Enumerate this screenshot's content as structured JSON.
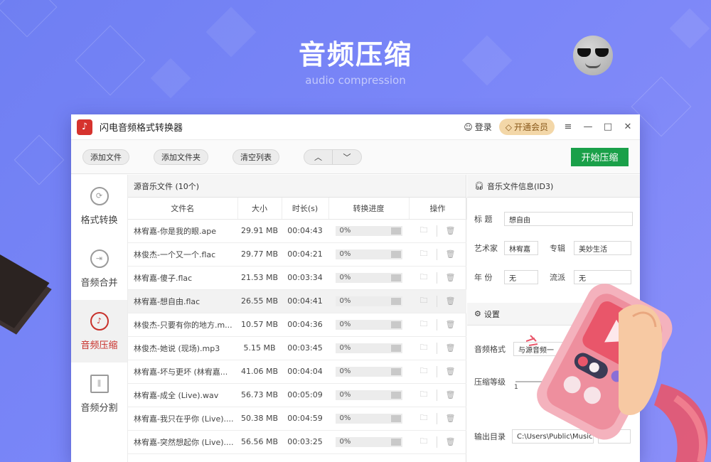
{
  "hero": {
    "title": "音频压缩",
    "subtitle": "audio compression"
  },
  "app": {
    "title": "闪电音频格式转换器",
    "login_label": "登录",
    "vip_label": "开通会员",
    "window_controls": [
      "≡",
      "—",
      "□",
      "✕"
    ]
  },
  "toolbar": {
    "add_file": "添加文件",
    "add_folder": "添加文件夹",
    "clear_list": "清空列表",
    "move_up": "︿",
    "move_down": "﹀",
    "start": "开始压缩"
  },
  "sidebar": {
    "items": [
      {
        "label": "格式转换",
        "icon": "refresh-icon"
      },
      {
        "label": "音频合并",
        "icon": "merge-icon"
      },
      {
        "label": "音频压缩",
        "icon": "music-note-icon",
        "active": true
      },
      {
        "label": "音频分割",
        "icon": "split-icon"
      }
    ]
  },
  "file_list": {
    "header": "源音乐文件 (10个)",
    "columns": [
      "文件名",
      "大小",
      "时长(s)",
      "转换进度",
      "操作"
    ],
    "rows": [
      {
        "name": "林宥嘉-你是我的眼.ape",
        "size": "29.91 MB",
        "duration": "00:04:43",
        "progress": "0%"
      },
      {
        "name": "林俊杰-一个又一个.flac",
        "size": "29.77 MB",
        "duration": "00:04:21",
        "progress": "0%"
      },
      {
        "name": "林宥嘉-傻子.flac",
        "size": "21.53 MB",
        "duration": "00:03:34",
        "progress": "0%"
      },
      {
        "name": "林宥嘉-想自由.flac",
        "size": "26.55 MB",
        "duration": "00:04:41",
        "progress": "0%",
        "selected": true
      },
      {
        "name": "林俊杰-只要有你的地方.m...",
        "size": "10.57 MB",
        "duration": "00:04:36",
        "progress": "0%"
      },
      {
        "name": "林俊杰-她说 (现场).mp3",
        "size": "5.15 MB",
        "duration": "00:03:45",
        "progress": "0%"
      },
      {
        "name": "林宥嘉-坏与更坏 (林宥嘉...",
        "size": "41.06 MB",
        "duration": "00:04:04",
        "progress": "0%"
      },
      {
        "name": "林宥嘉-成全 (Live).wav",
        "size": "56.73 MB",
        "duration": "00:05:09",
        "progress": "0%"
      },
      {
        "name": "林宥嘉-我只在乎你 (Live)....",
        "size": "50.38 MB",
        "duration": "00:04:59",
        "progress": "0%"
      },
      {
        "name": "林宥嘉-突然想起你 (Live)....",
        "size": "56.56 MB",
        "duration": "00:03:25",
        "progress": "0%"
      }
    ]
  },
  "id3": {
    "header": "音乐文件信息(ID3)",
    "title_label": "标    题",
    "title_value": "想自由",
    "artist_label": "艺术家",
    "artist_value": "林宥嘉",
    "album_label": "专辑",
    "album_value": "美妙生活",
    "year_label": "年    份",
    "year_value": "无",
    "genre_label": "流派",
    "genre_value": "无"
  },
  "settings": {
    "header": "设置",
    "format_label": "音频格式",
    "format_value": "与源音频一",
    "level_label": "压缩等级",
    "level_min": "1",
    "output_label": "输出目录",
    "output_value": "C:\\Users\\Public\\Music\\"
  },
  "colors": {
    "accent_green": "#1aa049",
    "active_red": "#c8312b",
    "bg_purple": "#7a86f8",
    "vip_gold": "#f3d7a8"
  }
}
